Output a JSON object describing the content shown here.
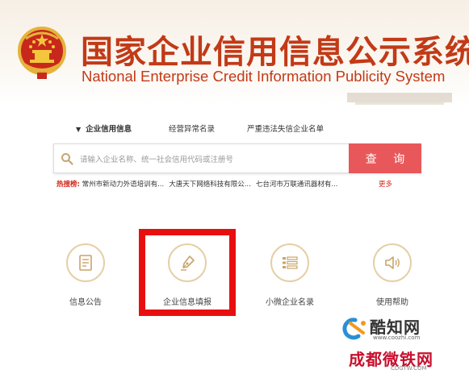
{
  "header": {
    "title_cn": "国家企业信用信息公示系统",
    "title_en": "National Enterprise Credit Information Publicity System"
  },
  "search": {
    "tabs": [
      {
        "label": "企业信用信息",
        "active": true
      },
      {
        "label": "经营异常名录",
        "active": false
      },
      {
        "label": "严重违法失信企业名单",
        "active": false
      }
    ],
    "placeholder": "请输入企业名称、统一社会信用代码或注册号",
    "button_label": "查 询"
  },
  "hot_search": {
    "label": "热搜榜:",
    "items": [
      "常州市新动力外语培训有...",
      "大唐天下网络科技有限公...",
      "七台河市万联通讯器材有..."
    ],
    "more": "更多"
  },
  "features": [
    {
      "label": "信息公告",
      "icon": "document-icon"
    },
    {
      "label": "企业信息填报",
      "icon": "pen-nib-icon"
    },
    {
      "label": "小微企业名录",
      "icon": "list-icon"
    },
    {
      "label": "使用帮助",
      "icon": "speaker-icon"
    }
  ],
  "watermarks": {
    "site1_name": "酷知网",
    "site1_url": "www.coozhi.com",
    "site2_name": "成都微铁网",
    "site2_url": "CDGTW.COM"
  },
  "colors": {
    "brand_red": "#c23a17",
    "search_button": "#e8585a",
    "highlight_box": "#e8100f",
    "icon_ring": "#e6cfa6"
  }
}
